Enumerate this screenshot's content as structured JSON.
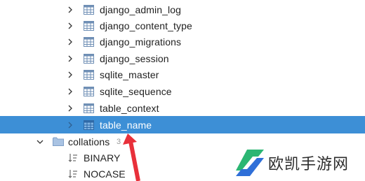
{
  "tables": [
    {
      "label": "django_admin_log"
    },
    {
      "label": "django_content_type"
    },
    {
      "label": "django_migrations"
    },
    {
      "label": "django_session"
    },
    {
      "label": "sqlite_master"
    },
    {
      "label": "sqlite_sequence"
    },
    {
      "label": "table_context"
    },
    {
      "label": "table_name",
      "selected": true
    }
  ],
  "collations": {
    "label": "collations",
    "count": "3",
    "items": [
      {
        "label": "BINARY"
      },
      {
        "label": "NOCASE"
      }
    ]
  },
  "watermark": {
    "text": "欧凯手游网"
  },
  "colors": {
    "selection": "#3d8fd6",
    "table_icon": "#6f8fb5",
    "folder_icon": "#8aa9cf",
    "arrow": "#e8303a",
    "watermark_logo_green": "#2bb673",
    "watermark_logo_blue": "#2f6fd8"
  }
}
